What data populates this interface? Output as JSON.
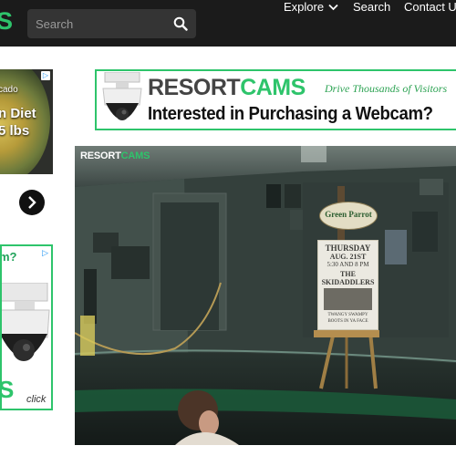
{
  "header": {
    "logo_fragment": "S",
    "search": {
      "placeholder": "Search"
    },
    "nav": {
      "explore": "Explore",
      "search": "Search",
      "contact": "Contact Us"
    }
  },
  "ads": {
    "left_top": {
      "line1": "cado",
      "line2": "n Diet",
      "line3": "5 lbs"
    },
    "left_bottom": {
      "title": "m?",
      "brand_fragment": "S",
      "cta": "click"
    },
    "banner": {
      "brand_part1": "RESORT",
      "brand_part2": "CAMS",
      "tagline": "Drive Thousands of Visitors",
      "headline": "Interested in Purchasing a Webcam?"
    }
  },
  "webcam": {
    "watermark_part1": "RESORT",
    "watermark_part2": "CAMS",
    "sign_text": "Green Parrot",
    "poster": {
      "line1": "THURSDAY",
      "line2": "AUG. 21ST",
      "line3": "5:30 AND 8 PM",
      "line4": "THE",
      "line5": "SKIDADDLERS",
      "line6": "TWANGY SWAMPY",
      "line7": "BOOTS IN YA FACE"
    }
  },
  "colors": {
    "accent": "#2ec46b",
    "topbar": "#1b1b1b",
    "search_bg": "#343434"
  }
}
